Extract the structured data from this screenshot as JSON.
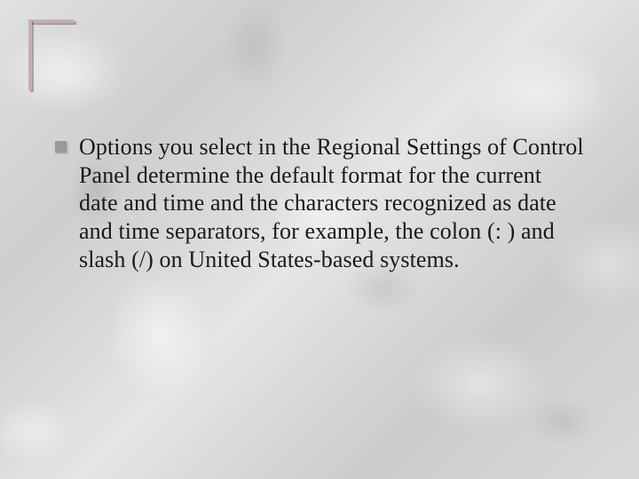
{
  "slide": {
    "bullets": [
      {
        "text": "Options you select in the Regional Settings of Control Panel determine the default format for the current date and time and the characters recognized as date and time separators, for example, the colon (: ) and slash (/) on United States-based systems."
      }
    ]
  },
  "colors": {
    "frame": "#c5aebb",
    "bullet": "#9a9a9a",
    "text": "#1a1a1a"
  }
}
